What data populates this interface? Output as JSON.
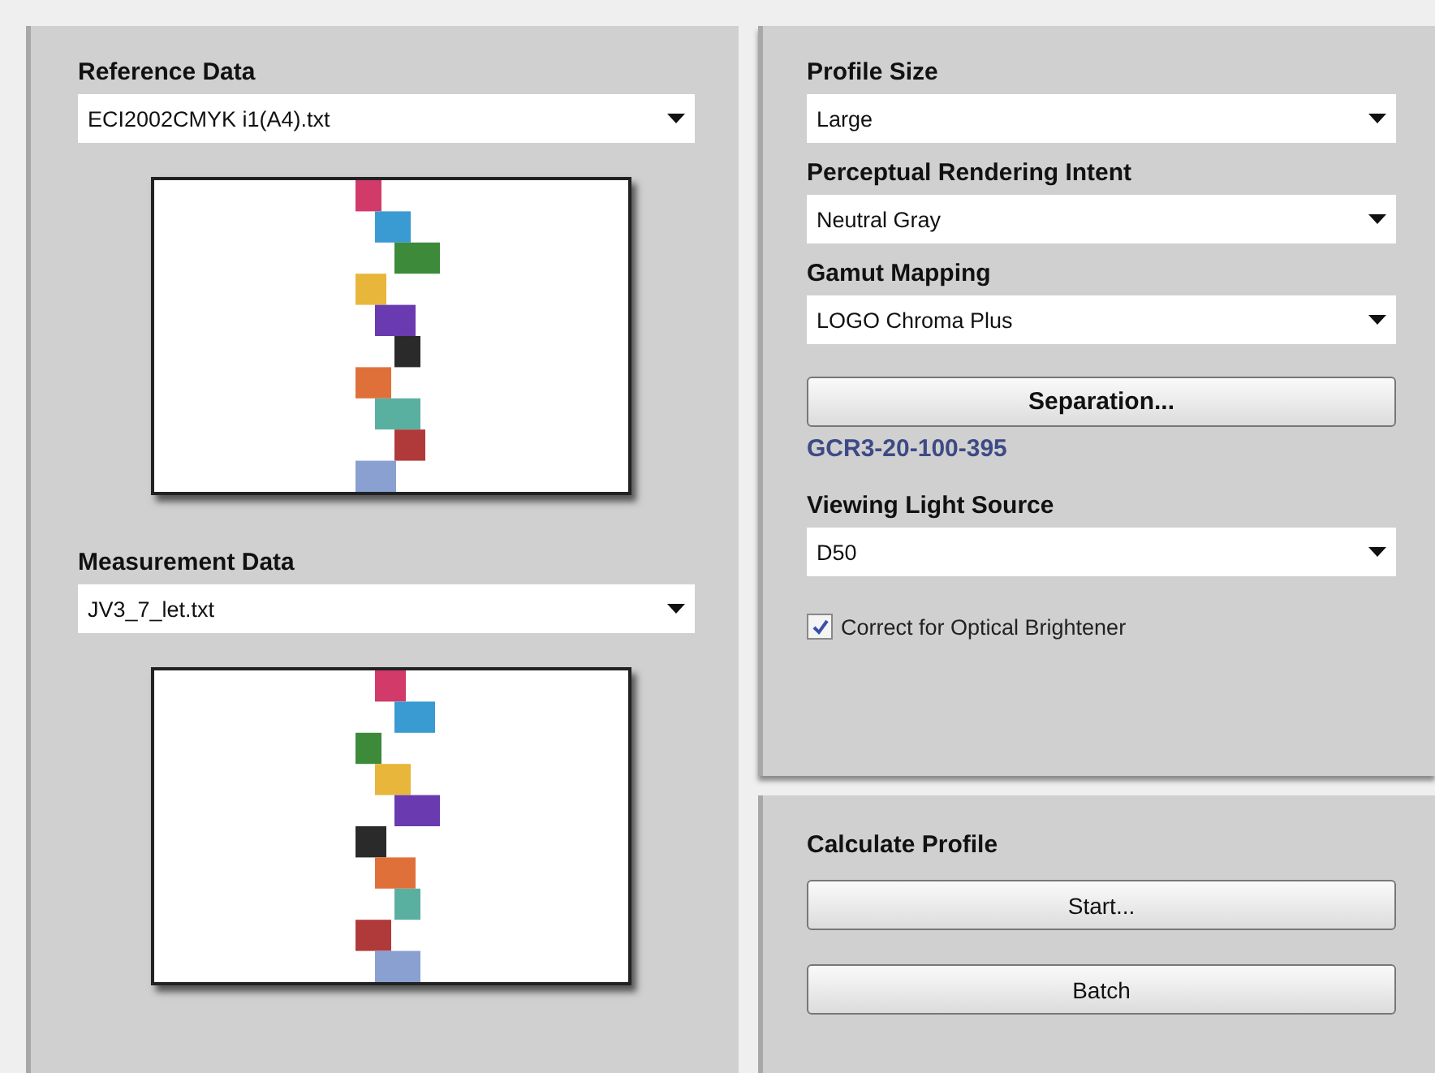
{
  "left_panel": {
    "sections": [
      {
        "label": "Reference Data",
        "dropdown": {
          "value": "ECI2002CMYK i1(A4).txt"
        }
      },
      {
        "label": "Measurement Data",
        "dropdown": {
          "value": "JV3_7_let.txt"
        }
      }
    ]
  },
  "settings_panel": {
    "items": [
      {
        "kind": "label",
        "text": "Profile Size"
      },
      {
        "kind": "dropdown",
        "value": "Large"
      },
      {
        "kind": "label",
        "text": "Perceptual Rendering Intent"
      },
      {
        "kind": "dropdown",
        "value": "Neutral Gray"
      },
      {
        "kind": "label",
        "text": "Gamut Mapping"
      },
      {
        "kind": "dropdown",
        "value": "LOGO Chroma Plus"
      },
      {
        "kind": "button",
        "text": "Separation..."
      },
      {
        "kind": "link",
        "text": "GCR3-20-100-395"
      },
      {
        "kind": "label",
        "text": "Viewing Light Source"
      },
      {
        "kind": "dropdown",
        "value": "D50"
      },
      {
        "kind": "checkbox",
        "text": "Correct for Optical Brightener",
        "checked": true
      }
    ]
  },
  "calculate_panel": {
    "title": "Calculate Profile",
    "buttons": [
      "Start...",
      "Batch"
    ]
  }
}
